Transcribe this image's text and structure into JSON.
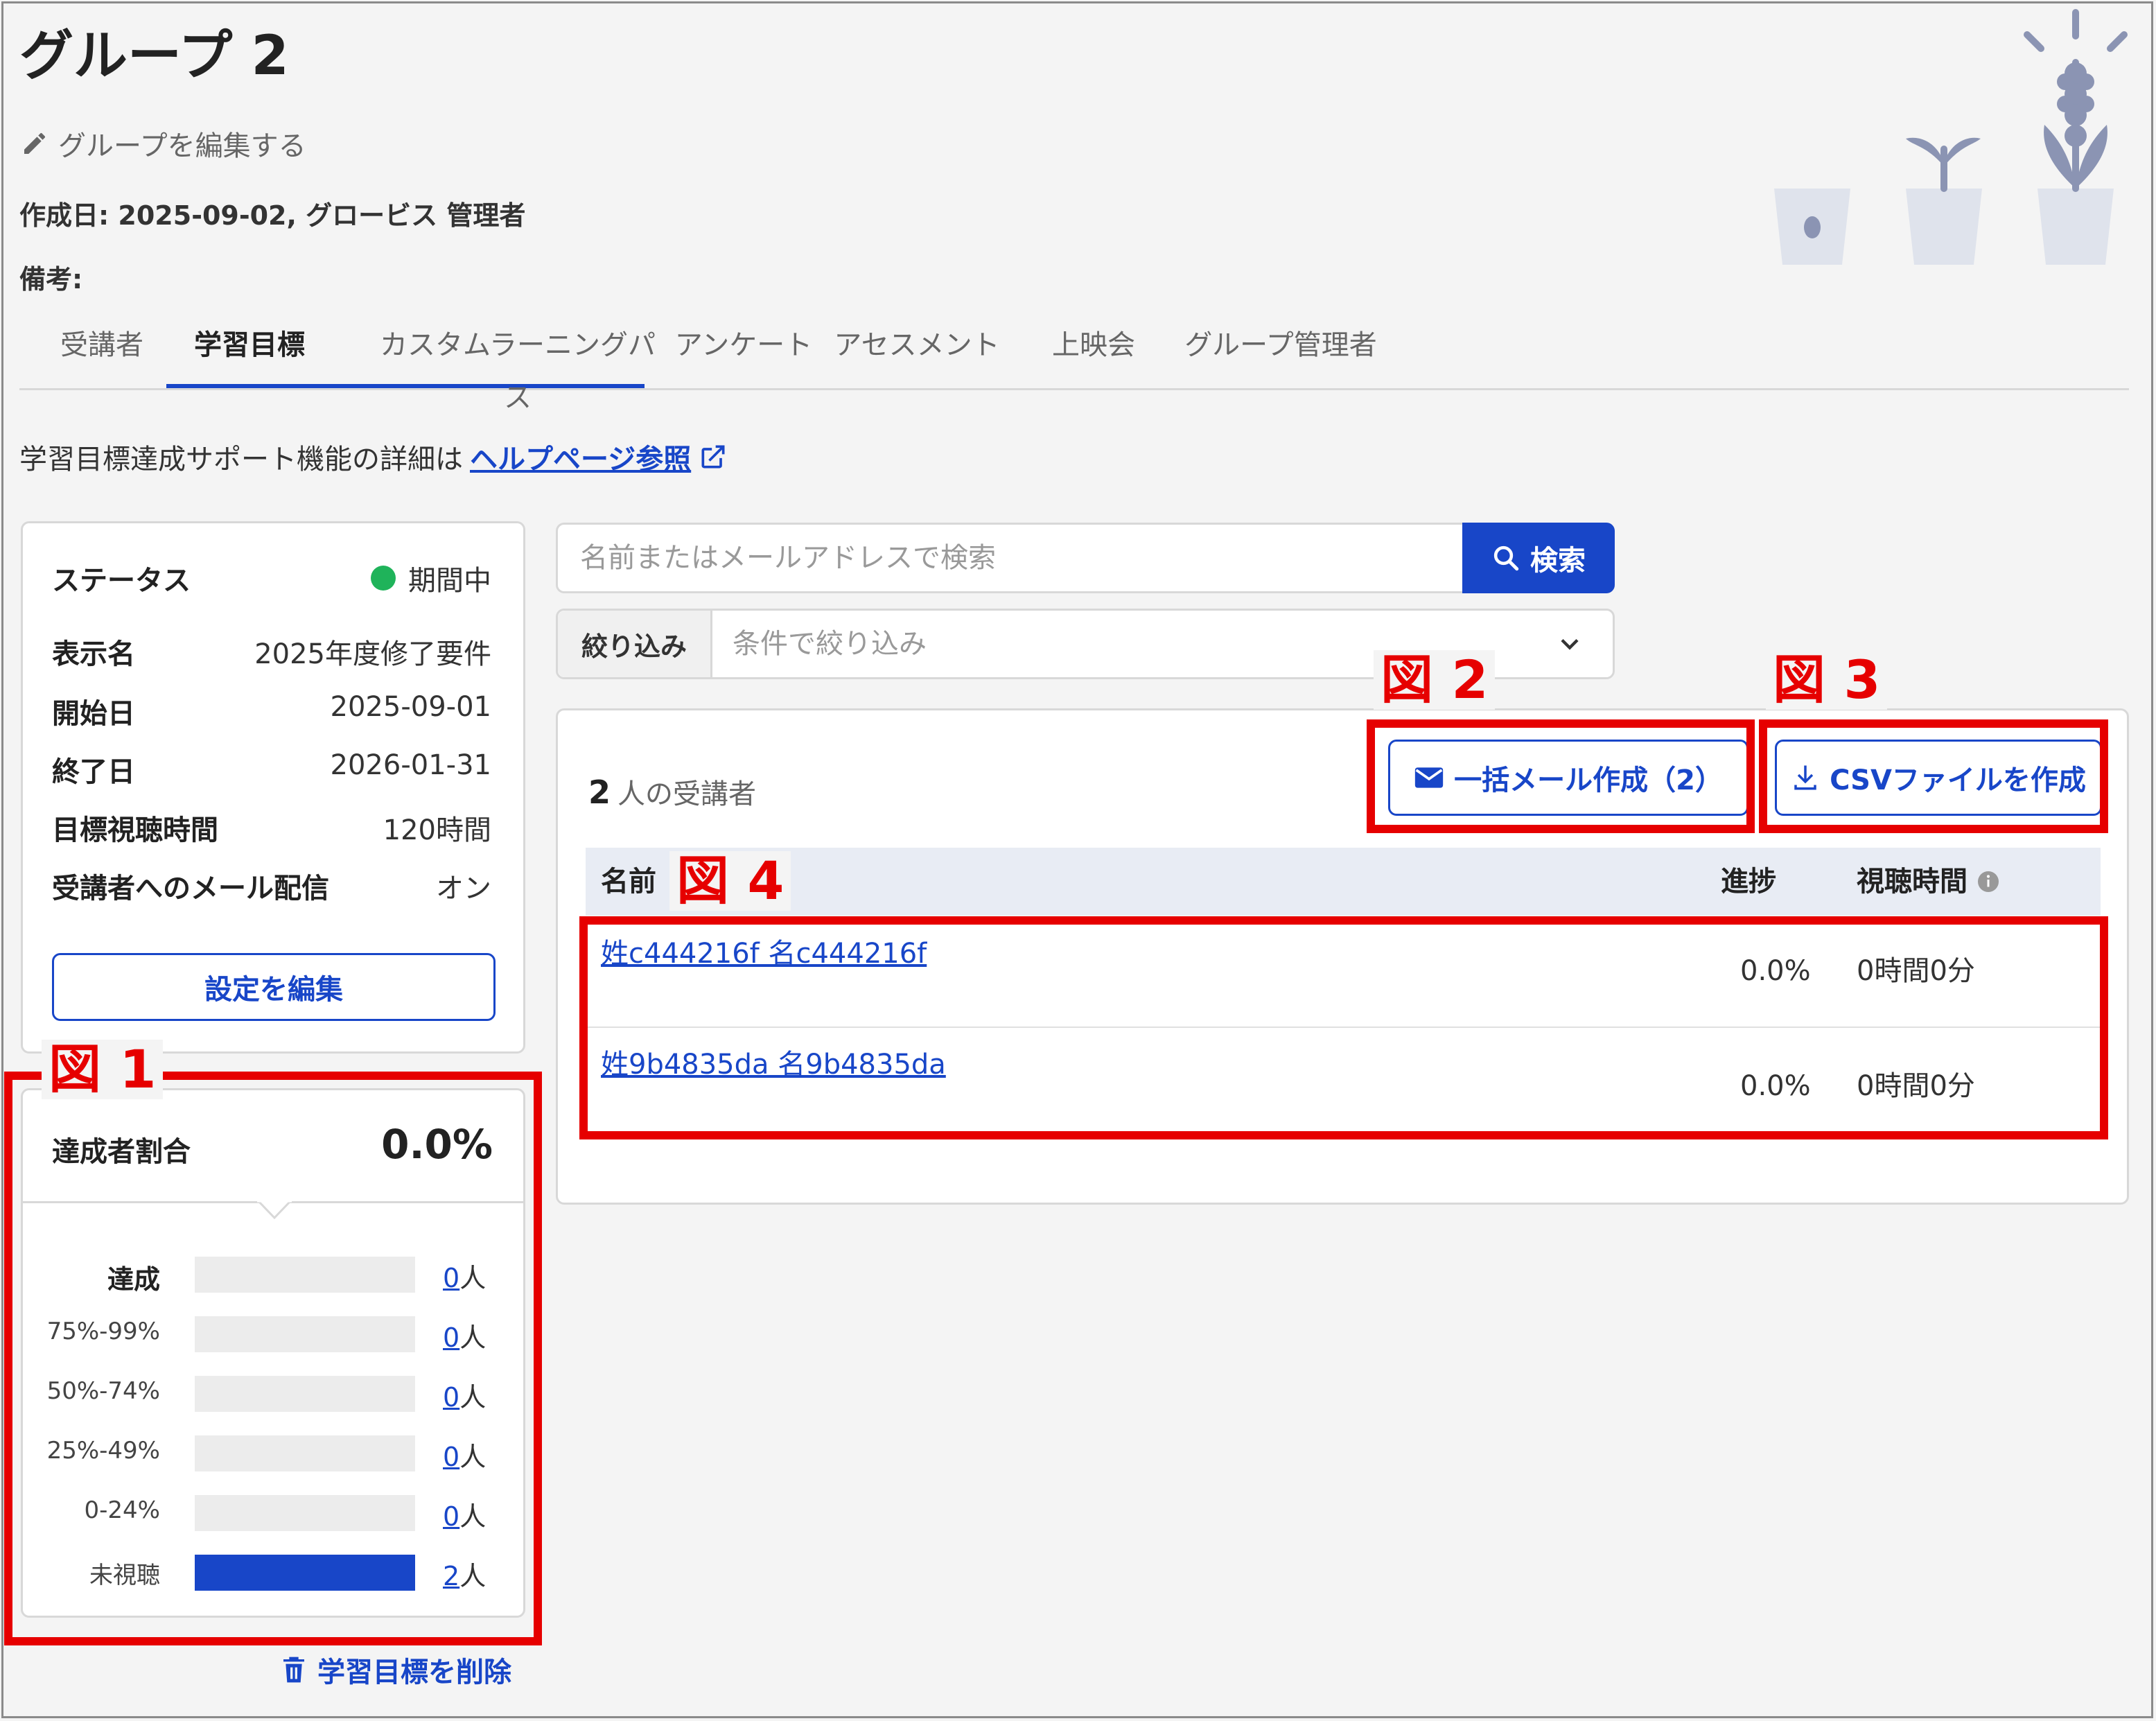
{
  "page": {
    "title": "グループ 2",
    "edit_link": "グループを編集する",
    "created": "作成日: 2025-09-02, グロービス 管理者",
    "notes_label": "備考:"
  },
  "tabs": [
    {
      "label": "受講者"
    },
    {
      "label": "学習目標"
    },
    {
      "label": "カスタムラーニングパス"
    },
    {
      "label": "アンケート"
    },
    {
      "label": "アセスメント"
    },
    {
      "label": "上映会"
    },
    {
      "label": "グループ管理者"
    }
  ],
  "active_tab": "学習目標",
  "help": {
    "text": "学習目標達成サポート機能の詳細は",
    "link": "ヘルプページ参照"
  },
  "status": {
    "status_label": "ステータス",
    "status_value": "期間中",
    "status_color": "#1fb35a",
    "rows": [
      {
        "label": "表示名",
        "value": "2025年度修了要件"
      },
      {
        "label": "開始日",
        "value": "2025-09-01"
      },
      {
        "label": "終了日",
        "value": "2026-01-31"
      },
      {
        "label": "目標視聴時間",
        "value": "120時間"
      },
      {
        "label": "受講者へのメール配信",
        "value": "オン"
      }
    ],
    "edit_button": "設定を編集"
  },
  "achievement": {
    "label": "達成者割合",
    "value": "0.0%",
    "unit": "人",
    "bars": [
      {
        "label": "達成",
        "count": "0",
        "fraction": 0
      },
      {
        "label": "75%-99%",
        "count": "0",
        "fraction": 0
      },
      {
        "label": "50%-74%",
        "count": "0",
        "fraction": 0
      },
      {
        "label": "25%-49%",
        "count": "0",
        "fraction": 0
      },
      {
        "label": "0-24%",
        "count": "0",
        "fraction": 0
      },
      {
        "label": "未視聴",
        "count": "2",
        "fraction": 1
      }
    ]
  },
  "delete_link": "学習目標を削除",
  "search": {
    "placeholder": "名前またはメールアドレスで検索",
    "button": "検索"
  },
  "filter": {
    "label": "絞り込み",
    "placeholder": "条件で絞り込み"
  },
  "learners": {
    "count": "2",
    "count_suffix": "人の受講者",
    "mail_button": "一括メール作成（2）",
    "csv_button": "CSVファイルを作成",
    "columns": {
      "name": "名前",
      "progress": "進捗",
      "time": "視聴時間"
    },
    "rows": [
      {
        "name": "姓c444216f 名c444216f",
        "progress": "0.0%",
        "time": "0時間0分"
      },
      {
        "name": "姓9b4835da 名9b4835da",
        "progress": "0.0%",
        "time": "0時間0分"
      }
    ]
  },
  "annotations": {
    "fig1": "図 1",
    "fig2": "図 2",
    "fig3": "図 3",
    "fig4": "図 4"
  },
  "colors": {
    "accent": "#1846c8",
    "annotation": "#e60000"
  }
}
